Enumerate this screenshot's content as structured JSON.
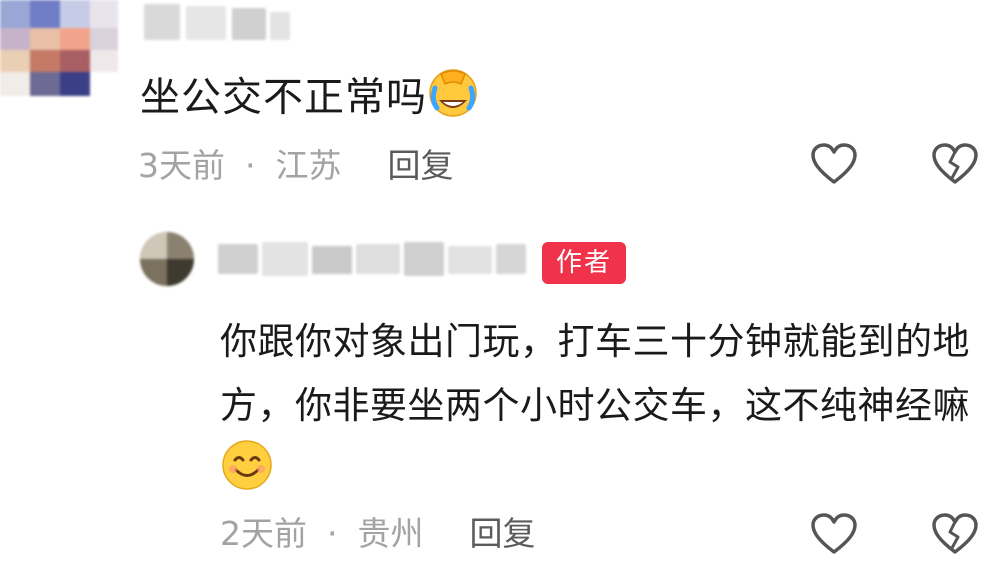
{
  "comment": {
    "text": "坐公交不正常吗",
    "emoji": "crying-laughing-emoji",
    "time": "3天前",
    "separator": "·",
    "location": "江苏",
    "reply_label": "回复"
  },
  "reply": {
    "author_badge": "作者",
    "text": "你跟你对象出门玩，打车三十分钟就能到的地方，你非要坐两个小时公交车，这不纯神经嘛",
    "emoji": "smiling-emoji",
    "time": "2天前",
    "separator": "·",
    "location": "贵州",
    "reply_label": "回复"
  },
  "colors": {
    "badge": "#f0324b",
    "meta": "#a3a3a3",
    "reply_link": "#5b5b5b"
  }
}
